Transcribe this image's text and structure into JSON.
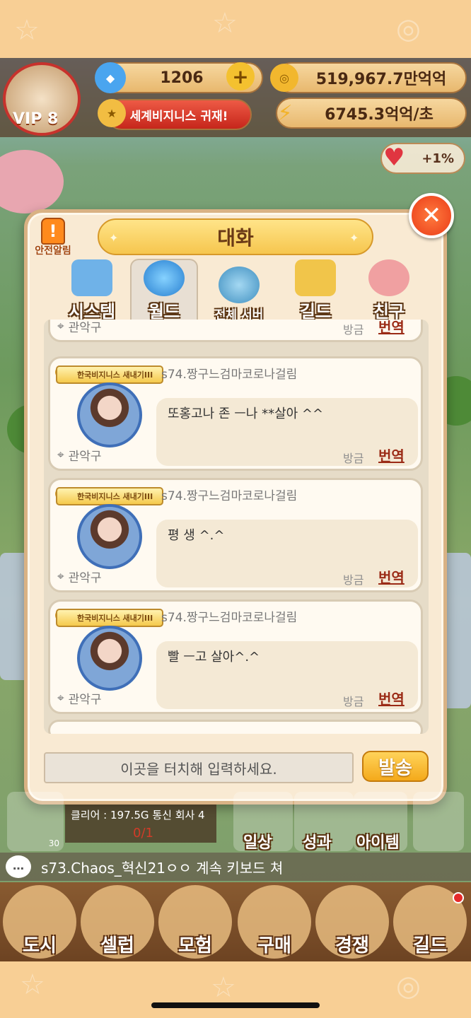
{
  "hud": {
    "vip": "VIP 8",
    "gems": "1206",
    "coins": "519,967.7만억억",
    "title_badge": "세계비지니스 귀재!",
    "income": "6745.3억억/초",
    "boost": "+1%"
  },
  "modal": {
    "title": "대화",
    "alert_label": "안전알림",
    "close_icon": "✕",
    "tabs": [
      {
        "label": "시스템",
        "icon": "computer-icon"
      },
      {
        "label": "월드",
        "icon": "globe-icon",
        "active": true
      },
      {
        "label": "전체 서버",
        "icon": "servers-icon"
      },
      {
        "label": "길드",
        "icon": "castle-icon"
      },
      {
        "label": "친구",
        "icon": "friends-icon"
      }
    ]
  },
  "chat": {
    "top_card": {
      "location": "관악구",
      "time": "방금",
      "translate": "번역"
    },
    "messages": [
      {
        "badge": "한국비지니스 새내기III",
        "user": "s74.짱구느검마코로나걸림",
        "text": "또홍고나 존 ㅡ나 **살아 ^^",
        "location": "관악구",
        "time": "방금",
        "translate": "번역"
      },
      {
        "badge": "한국비지니스 새내기III",
        "user": "s74.짱구느검마코로나걸림",
        "text": "평 생 ^.^",
        "location": "관악구",
        "time": "방금",
        "translate": "번역"
      },
      {
        "badge": "한국비지니스 새내기III",
        "user": "s74.짱구느검마코로나걸림",
        "text": "빨 ㅡ고 살아^.^",
        "location": "관악구",
        "time": "방금",
        "translate": "번역"
      }
    ],
    "input_placeholder": "이곳을 터치해 입력하세요.",
    "send_label": "발송"
  },
  "background": {
    "mission_text": "클리어 : 197.5G 통신 회사 4",
    "mission_progress": "0/1",
    "count": "30",
    "labels": [
      "일상",
      "성과",
      "아이템"
    ],
    "ticker": "s73.Chaos_혁신21ㅇㅇ 계속 키보드 쳐"
  },
  "nav": [
    "도시",
    "셀럽",
    "모험",
    "구매",
    "경쟁",
    "길드"
  ],
  "colors": {
    "accent_orange": "#f4a91b",
    "modal_bg": "#f9ead3",
    "translate_red": "#9b2b16"
  }
}
